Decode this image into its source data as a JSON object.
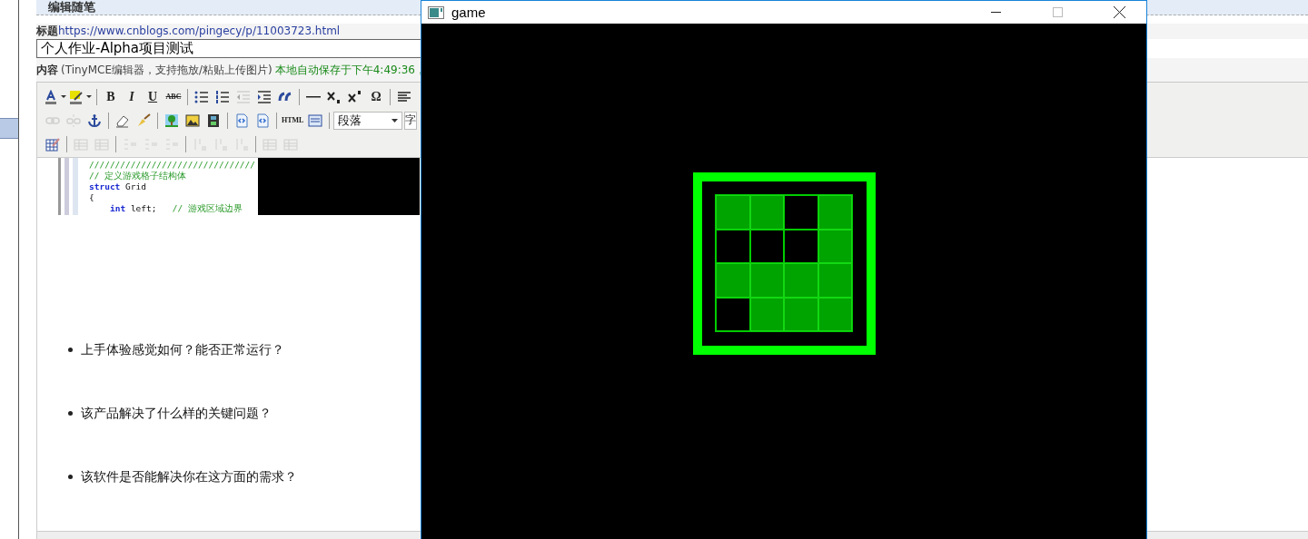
{
  "sidebar": {
    "items": [
      {
        "selected": true
      }
    ]
  },
  "editor": {
    "header": "编辑随笔",
    "title_label": "标题",
    "title_link": "https://www.cnblogs.com/pingecy/p/11003723.html",
    "title_value": "个人作业-Alpha项目测试",
    "content_label": "内容",
    "content_hint": "(TinyMCE编辑器，支持拖放/粘贴上传图片)",
    "autosave": "本地自动保存于下午4:49:36，"
  },
  "toolbar": [
    {
      "groups": [
        [
          {
            "kind": "text-color",
            "disabled": false
          },
          {
            "kind": "highlight",
            "disabled": false
          }
        ],
        [
          {
            "kind": "bold",
            "label": "B",
            "disabled": false
          },
          {
            "kind": "italic",
            "label": "I",
            "disabled": false
          },
          {
            "kind": "underline",
            "label": "U",
            "disabled": false
          },
          {
            "kind": "strike",
            "label": "ABC",
            "disabled": false
          }
        ],
        [
          {
            "kind": "bullets",
            "disabled": false
          },
          {
            "kind": "numbers",
            "disabled": false
          },
          {
            "kind": "outdent",
            "disabled": true
          },
          {
            "kind": "indent",
            "disabled": false
          },
          {
            "kind": "quote",
            "disabled": false
          }
        ],
        [
          {
            "kind": "rule",
            "disabled": false
          },
          {
            "kind": "sub",
            "disabled": false
          },
          {
            "kind": "sup",
            "disabled": false
          },
          {
            "kind": "char",
            "label": "Ω",
            "disabled": false
          }
        ],
        [
          {
            "kind": "align",
            "disabled": false
          }
        ]
      ]
    },
    {
      "groups": [
        [
          {
            "kind": "link",
            "disabled": true
          },
          {
            "kind": "unlink",
            "disabled": true
          },
          {
            "kind": "anchor",
            "disabled": false
          }
        ],
        [
          {
            "kind": "eraser",
            "disabled": false
          },
          {
            "kind": "brush",
            "disabled": false
          }
        ],
        [
          {
            "kind": "tree",
            "disabled": false
          },
          {
            "kind": "image",
            "disabled": false
          },
          {
            "kind": "film",
            "disabled": false
          }
        ],
        [
          {
            "kind": "code",
            "disabled": false
          },
          {
            "kind": "code",
            "disabled": false
          }
        ],
        [
          {
            "kind": "html",
            "label": "HTML",
            "disabled": false
          },
          {
            "kind": "window",
            "disabled": false
          }
        ],
        [
          {
            "kind": "select",
            "label": "段落",
            "disabled": false
          },
          {
            "kind": "select",
            "label": "字",
            "disabled": false
          }
        ]
      ]
    },
    {
      "groups": [
        [
          {
            "kind": "table-edit",
            "disabled": false
          }
        ],
        [
          {
            "kind": "table",
            "disabled": true
          },
          {
            "kind": "table",
            "disabled": true
          }
        ],
        [
          {
            "kind": "row",
            "disabled": true
          },
          {
            "kind": "row",
            "disabled": true
          },
          {
            "kind": "row",
            "disabled": true
          }
        ],
        [
          {
            "kind": "col",
            "disabled": true
          },
          {
            "kind": "col",
            "disabled": true
          },
          {
            "kind": "col",
            "disabled": true
          }
        ],
        [
          {
            "kind": "table",
            "disabled": true
          },
          {
            "kind": "table",
            "disabled": true
          }
        ]
      ]
    }
  ],
  "code_lines": [
    {
      "indented": false,
      "tokens": [
        {
          "kind": "comment",
          "text": "////////////////////////////////"
        }
      ]
    },
    {
      "indented": false,
      "tokens": [
        {
          "kind": "comment",
          "text": "// 定义游戏格子结构体"
        }
      ]
    },
    {
      "indented": false,
      "tokens": [
        {
          "kind": "keyword",
          "text": "struct"
        },
        {
          "kind": "plain",
          "text": " Grid"
        }
      ]
    },
    {
      "indented": false,
      "tokens": [
        {
          "kind": "plain",
          "text": "{"
        }
      ]
    },
    {
      "indented": true,
      "tokens": [
        {
          "kind": "keyword",
          "text": "int"
        },
        {
          "kind": "plain",
          "text": " left;   "
        },
        {
          "kind": "comment",
          "text": "// 游戏区域边界"
        }
      ]
    }
  ],
  "bullets": [
    "上手体验感觉如何？能否正常运行？",
    "该产品解决了什么样的关键问题？",
    "该软件是否能解决你在这方面的需求？"
  ],
  "game_window": {
    "title": "game",
    "grid": [
      {
        "cells": [
          {
            "on": true
          },
          {
            "on": true
          },
          {
            "on": false
          },
          {
            "on": true
          }
        ]
      },
      {
        "cells": [
          {
            "on": false
          },
          {
            "on": false
          },
          {
            "on": false
          },
          {
            "on": true
          }
        ]
      },
      {
        "cells": [
          {
            "on": true
          },
          {
            "on": true
          },
          {
            "on": true
          },
          {
            "on": true
          }
        ]
      },
      {
        "cells": [
          {
            "on": false
          },
          {
            "on": true
          },
          {
            "on": true
          },
          {
            "on": true
          }
        ]
      }
    ]
  }
}
